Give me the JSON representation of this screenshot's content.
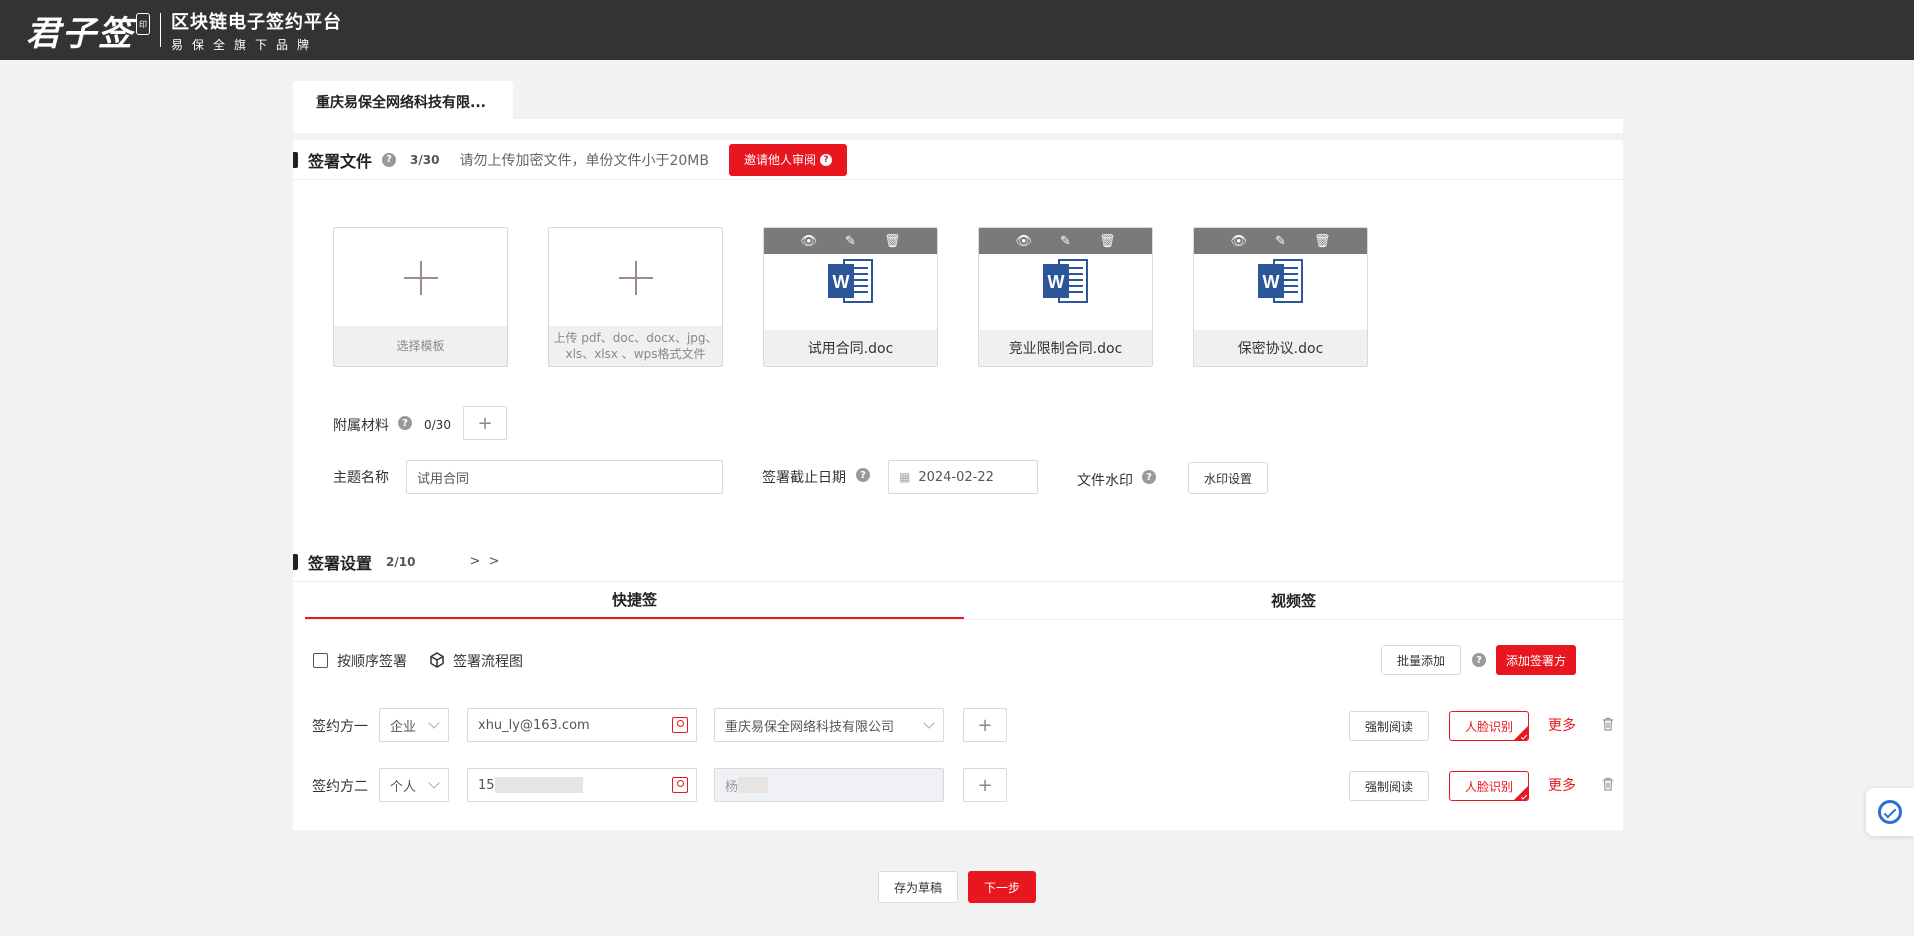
{
  "header": {
    "logo_mark": "君子签",
    "logo_seal": "印",
    "platform_title": "区块链电子签约平台",
    "platform_subtitle": "易保全旗下品牌"
  },
  "company_tab": "重庆易保全网络科技有限...",
  "sign_files": {
    "title": "签署文件",
    "count": "3/30",
    "hint": "请勿上传加密文件，单份文件小于20MB",
    "invite_review_label": "邀请他人审阅",
    "template_caption": "选择模板",
    "upload_caption": "上传 pdf、doc、docx、jpg、xls、xlsx 、wps格式文件",
    "files": [
      {
        "name": "试用合同.doc"
      },
      {
        "name": "竞业限制合同.doc"
      },
      {
        "name": "保密协议.doc"
      }
    ],
    "attachment_label": "附属材料",
    "attachment_count": "0/30",
    "subject_label": "主题名称",
    "subject_value": "试用合同",
    "deadline_label": "签署截止日期",
    "deadline_value": "2024-02-22",
    "watermark_label": "文件水印",
    "watermark_button": "水印设置"
  },
  "sign_settings": {
    "title": "签署设置",
    "count": "2/10",
    "expand": "> >",
    "tabs": [
      {
        "label": "快捷签",
        "active": true
      },
      {
        "label": "视频签",
        "active": false
      }
    ],
    "sequential_label": "按顺序签署",
    "flowchart_label": "签署流程图",
    "batch_add_label": "批量添加",
    "add_signer_label": "添加签署方",
    "signers": [
      {
        "label": "签约方一",
        "type": "企业",
        "account": "xhu_ly@163.com",
        "name": "重庆易保全网络科技有限公司",
        "force_read": "强制阅读",
        "face_verify": "人脸识别",
        "more": "更多"
      },
      {
        "label": "签约方二",
        "type": "个人",
        "account": "15",
        "name": "杨",
        "force_read": "强制阅读",
        "face_verify": "人脸识别",
        "more": "更多"
      }
    ]
  },
  "footer": {
    "save_draft": "存为草稿",
    "next_step": "下一步"
  },
  "colors": {
    "accent": "#e8161e",
    "header_bg": "#333333",
    "word_blue": "#2b579a"
  }
}
